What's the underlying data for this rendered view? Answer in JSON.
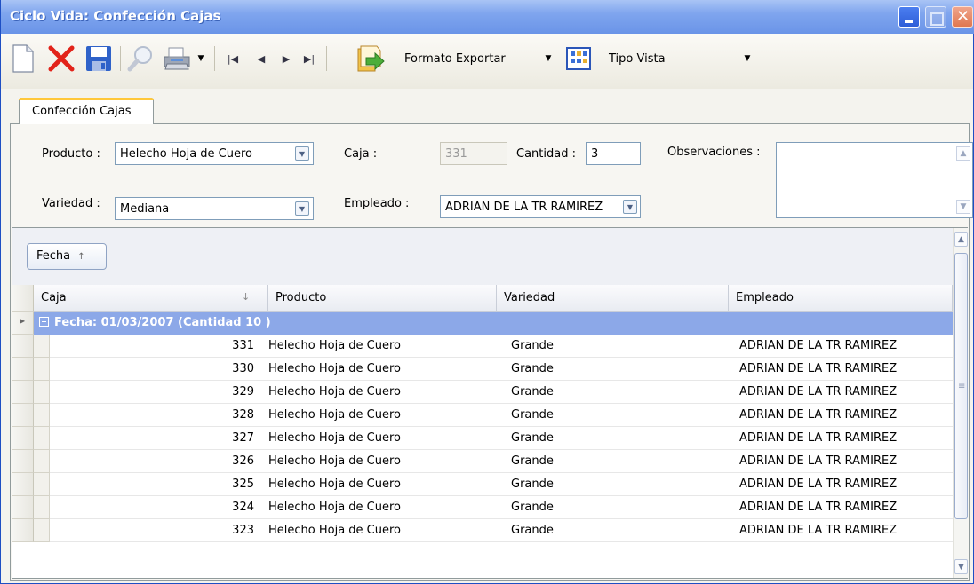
{
  "window": {
    "title": "Ciclo Vida: Confección Cajas"
  },
  "toolbar": {
    "export_format": "Formato Exportar",
    "view_type": "Tipo Vista"
  },
  "tab": {
    "label": "Confección Cajas"
  },
  "form": {
    "producto_label": "Producto :",
    "producto_value": "Helecho Hoja de Cuero",
    "caja_label": "Caja :",
    "caja_value": "331",
    "cantidad_label": "Cantidad :",
    "cantidad_value": "3",
    "observaciones_label": "Observaciones :",
    "variedad_label": "Variedad :",
    "variedad_value": "Mediana",
    "empleado_label": "Empleado :",
    "empleado_value": "ADRIAN DE LA TR RAMIREZ"
  },
  "grid": {
    "group_chip": "Fecha",
    "columns": [
      "Caja",
      "Producto",
      "Variedad",
      "Empleado"
    ],
    "group_row": "Fecha: 01/03/2007 (Cantidad 10 )",
    "rows": [
      [
        "331",
        "Helecho Hoja de Cuero",
        "Grande",
        "ADRIAN DE LA TR RAMIREZ"
      ],
      [
        "330",
        "Helecho Hoja de Cuero",
        "Grande",
        "ADRIAN DE LA TR RAMIREZ"
      ],
      [
        "329",
        "Helecho Hoja de Cuero",
        "Grande",
        "ADRIAN DE LA TR RAMIREZ"
      ],
      [
        "328",
        "Helecho Hoja de Cuero",
        "Grande",
        "ADRIAN DE LA TR RAMIREZ"
      ],
      [
        "327",
        "Helecho Hoja de Cuero",
        "Grande",
        "ADRIAN DE LA TR RAMIREZ"
      ],
      [
        "326",
        "Helecho Hoja de Cuero",
        "Grande",
        "ADRIAN DE LA TR RAMIREZ"
      ],
      [
        "325",
        "Helecho Hoja de Cuero",
        "Grande",
        "ADRIAN DE LA TR RAMIREZ"
      ],
      [
        "324",
        "Helecho Hoja de Cuero",
        "Grande",
        "ADRIAN DE LA TR RAMIREZ"
      ],
      [
        "323",
        "Helecho Hoja de Cuero",
        "Grande",
        "ADRIAN DE LA TR RAMIREZ"
      ]
    ]
  },
  "colors": {
    "title_bar": "#7fa5ee",
    "group_row": "#8ca8e8",
    "close_button": "#e0774f"
  }
}
